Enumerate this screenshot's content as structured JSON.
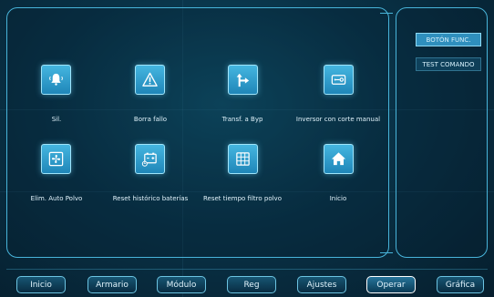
{
  "side_menu": [
    {
      "label": "BOTÓN FUNC.",
      "active": true
    },
    {
      "label": "TEST COMANDO",
      "active": false
    }
  ],
  "functions": [
    {
      "label": "Sil.",
      "icon": "bell-sound-icon"
    },
    {
      "label": "Borra fallo",
      "icon": "warning-triangle-icon"
    },
    {
      "label": "Transf. a Byp",
      "icon": "bypass-arrow-icon"
    },
    {
      "label": "Inversor con corte manual",
      "icon": "inverter-switch-icon"
    },
    {
      "label": "Elim. Auto Polvo",
      "icon": "fan-icon"
    },
    {
      "label": "Reset histórico baterías",
      "icon": "battery-reset-icon"
    },
    {
      "label": "Reset tiempo filtro polvo",
      "icon": "filter-grid-icon"
    },
    {
      "label": "Inicio",
      "icon": "home-icon"
    }
  ],
  "nav_bar": [
    {
      "label": "Inicio",
      "active": false
    },
    {
      "label": "Armario",
      "active": false
    },
    {
      "label": "Módulo",
      "active": false
    },
    {
      "label": "Reg",
      "active": false
    },
    {
      "label": "Ajustes",
      "active": false
    },
    {
      "label": "Operar",
      "active": true
    },
    {
      "label": "Gráfica",
      "active": false
    }
  ]
}
